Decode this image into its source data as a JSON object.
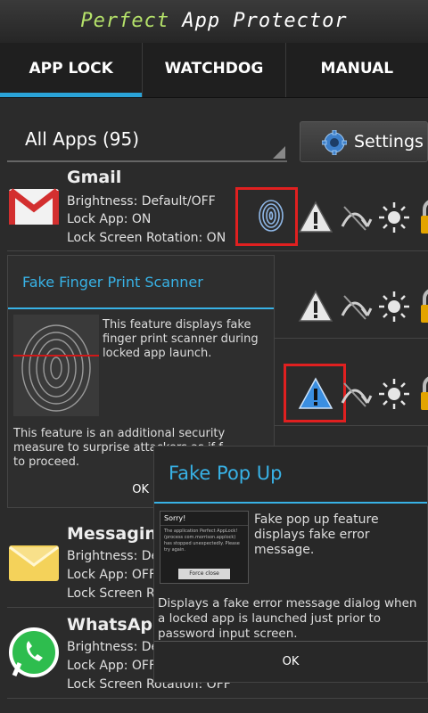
{
  "header": {
    "title_accent": "Perfect",
    "title_rest": " App Protector"
  },
  "tabs": [
    {
      "label": "APP LOCK",
      "active": true
    },
    {
      "label": "WATCHDOG",
      "active": false
    },
    {
      "label": "MANUAL",
      "active": false
    }
  ],
  "filter": {
    "selected": "All Apps (95)"
  },
  "settings_label": "Settings",
  "apps": [
    {
      "name": "Gmail",
      "brightness": "Brightness: Default/OFF",
      "lock": "Lock App: ON",
      "rotation": "Lock Screen Rotation: ON"
    },
    {
      "name": "Messaging",
      "brightness": "Brightness: De",
      "lock": "Lock App: OFF",
      "rotation": "Lock Screen Ro"
    },
    {
      "name": "WhatsApp",
      "brightness": "Brightness: De",
      "lock": "Lock App: OFF",
      "rotation": "Lock Screen Rotation: OFF"
    }
  ],
  "dialog_fingerprint": {
    "title": "Fake Finger Print Scanner",
    "desc1": "This feature displays fake finger print scanner during locked app launch.",
    "desc2": "This feature is an additional security measure to surprise attackers as if f",
    "desc2b": "to proceed.",
    "ok": "OK"
  },
  "dialog_popup": {
    "title": "Fake Pop Up",
    "desc1": "Fake pop up feature displays fake error message.",
    "desc2": "Displays a fake error message dialog when a locked app is launched just prior to password input screen.",
    "ok": "OK",
    "thumb_title": "Sorry!",
    "thumb_msg": "The application Perfect AppLock! (process com.morrison.applock) has stopped unexpectedly. Please try again.",
    "thumb_btn": "Force close"
  },
  "colors": {
    "accent": "#2aa3d8",
    "highlight": "#e02020",
    "dialog_title": "#38b2e6"
  }
}
